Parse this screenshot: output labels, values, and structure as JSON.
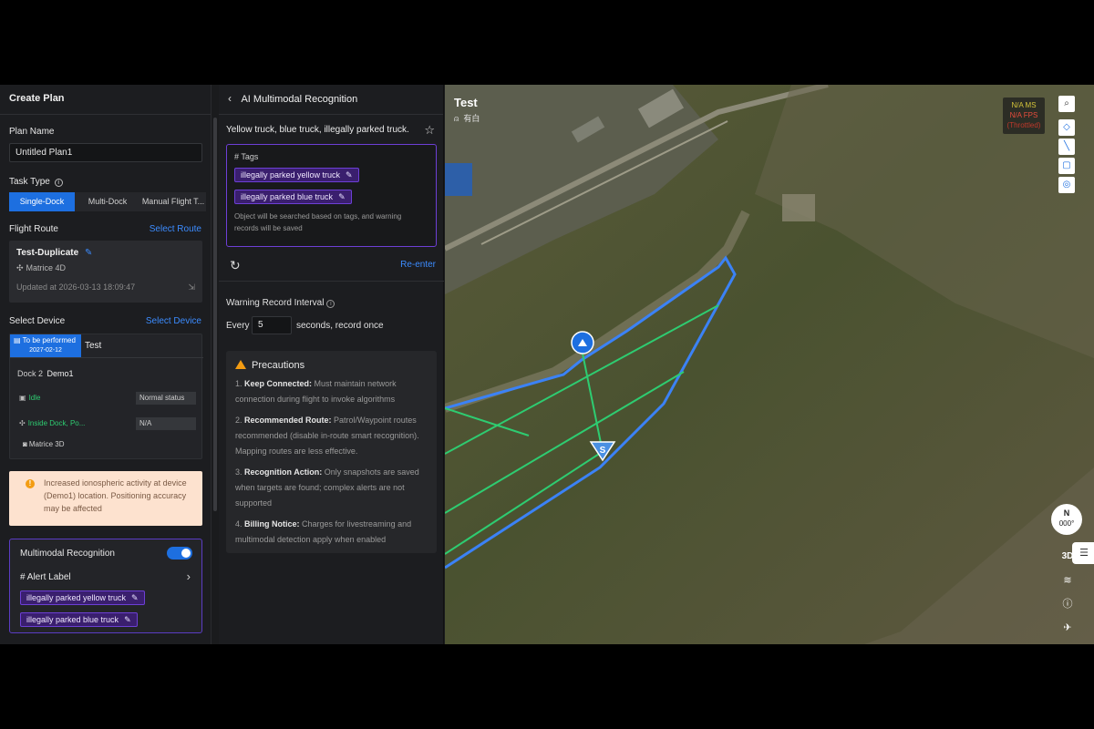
{
  "left_panel": {
    "title": "Create Plan",
    "plan_name_label": "Plan Name",
    "plan_name_value": "Untitled Plan1",
    "task_type_label": "Task Type",
    "task_tabs": [
      "Single-Dock",
      "Multi-Dock",
      "Manual Flight T..."
    ],
    "flight_route_label": "Flight Route",
    "select_route": "Select Route",
    "route": {
      "name": "Test-Duplicate",
      "model": "Matrice 4D",
      "updated": "Updated at 2026-03-13 18:09:47"
    },
    "select_device_label": "Select Device",
    "select_device_link": "Select Device",
    "device": {
      "badge_status": "To be performed",
      "badge_date": "2027-02-12",
      "tab": "Test",
      "dock_label": "Dock 2",
      "dock_name": "Demo1",
      "rows": [
        {
          "key": "Idle",
          "value": "Normal status"
        },
        {
          "key": "Inside Dock, Po...",
          "value": "N/A"
        }
      ],
      "aircraft": "Matrice 3D"
    },
    "warning": "Increased ionospheric activity at device (Demo1) location. Positioning accuracy may be affected",
    "multimodal": {
      "title": "Multimodal Recognition",
      "enabled": true,
      "alert_label": "# Alert Label",
      "tags": [
        "illegally parked yellow truck",
        "illegally parked blue truck"
      ]
    }
  },
  "middle_panel": {
    "title": "AI Multimodal Recognition",
    "prompt": "Yellow truck, blue truck, illegally parked truck.",
    "tags_title": "# Tags",
    "tags": [
      "illegally parked yellow truck",
      "illegally parked blue truck"
    ],
    "tags_note": "Object will be searched based on tags, and warning records will be saved",
    "reenter": "Re-enter",
    "interval_label": "Warning Record Interval",
    "every_label": "Every",
    "every_value": "5",
    "every_suffix": "seconds, record once",
    "precautions_title": "Precautions",
    "precautions": [
      {
        "num": "1.",
        "head": "Keep Connected:",
        "text": " Must maintain network connection during flight to invoke algorithms"
      },
      {
        "num": "2.",
        "head": "Recommended Route:",
        "text": " Patrol/Waypoint routes recommended (disable in-route smart recognition). Mapping routes are less effective."
      },
      {
        "num": "3.",
        "head": "Recognition Action:",
        "text": " Only snapshots are saved when targets are found; complex alerts are not supported"
      },
      {
        "num": "4.",
        "head": "Billing Notice:",
        "text": " Charges for livestreaming and multimodal detection apply when enabled"
      }
    ]
  },
  "map": {
    "title": "Test",
    "subtitle": "有白",
    "fps_ms": "N/A MS",
    "fps_fps": "N/A FPS",
    "fps_sub": "(Throttled)",
    "compass_n": "N",
    "compass_deg": "000°",
    "btn_3d": "3D",
    "colors": {
      "route": "#3b82f6",
      "scan": "#2ecc71",
      "terrain": "#4e5230"
    }
  }
}
